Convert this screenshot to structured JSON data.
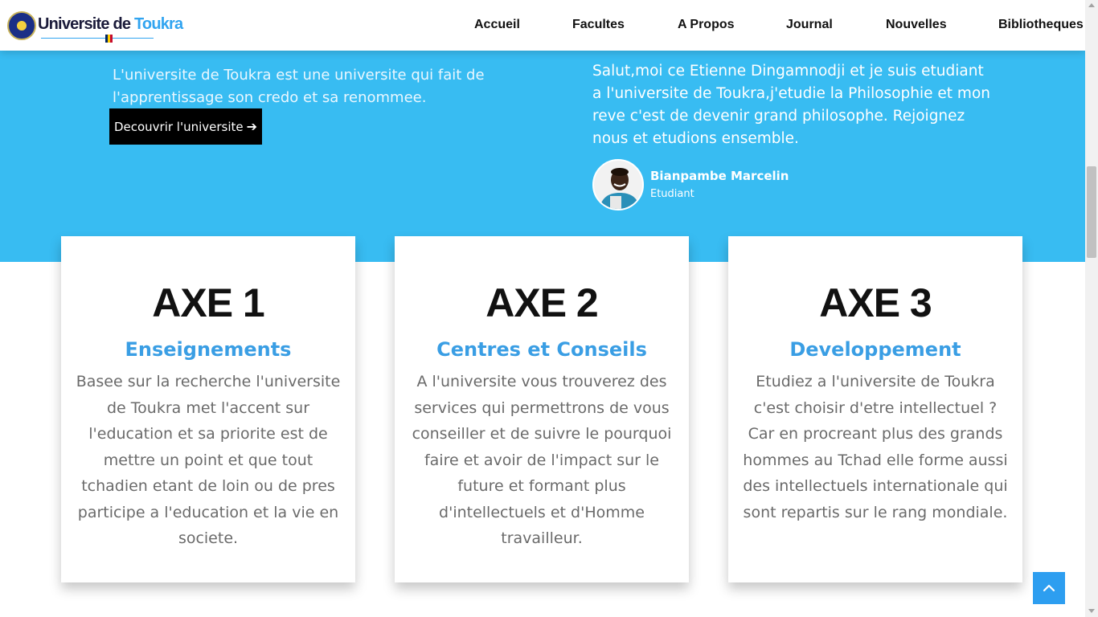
{
  "brand": {
    "name_part1": "Universite de ",
    "name_part2": "Toukra"
  },
  "nav": {
    "items": [
      {
        "label": "Accueil"
      },
      {
        "label": "Facultes"
      },
      {
        "label": "A Propos"
      },
      {
        "label": "Journal"
      },
      {
        "label": "Nouvelles"
      },
      {
        "label": "Bibliotheques"
      }
    ]
  },
  "hero": {
    "description": "L'universite de Toukra est une universite qui fait de l'apprentissage son credo et sa renommee.",
    "cta_label": "Decouvrir l'universite",
    "quote": "Salut,moi ce Etienne Dingamnodji et je suis etudiant a l'universite de Toukra,j'etudie la Philosophie et mon reve c'est de devenir grand philosophe. Rejoignez nous et etudions ensemble.",
    "person_name": "Bianpambe Marcelin",
    "person_role": "Etudiant"
  },
  "cards": [
    {
      "axe": "AXE 1",
      "title": "Enseignements",
      "text": "Basee sur la recherche l'universite de Toukra met l'accent sur l'education et sa priorite est de mettre un point et que tout tchadien etant de loin ou de pres participe a l'education et la vie en societe."
    },
    {
      "axe": "AXE 2",
      "title": "Centres et Conseils",
      "text": "A l'universite vous trouverez des services qui permettrons de vous conseiller et de suivre le pourquoi faire et avoir de l'impact sur le future et formant plus d'intellectuels et d'Homme travailleur."
    },
    {
      "axe": "AXE 3",
      "title": "Developpement",
      "text": "Etudiez a l'universite de Toukra c'est choisir d'etre intellectuel ? Car en procreant plus des grands hommes au Tchad elle forme aussi des intellectuels internationale qui sont repartis sur le rang mondiale."
    }
  ],
  "icons": {
    "cta": "arrow-right-icon",
    "back_to_top": "chevron-up-icon",
    "logo": "university-seal-icon"
  },
  "colors": {
    "hero_bg": "#38bcf2",
    "accent": "#3a9ee4",
    "cta_bg": "#000000",
    "back_to_top_bg": "#2d9ef0"
  }
}
